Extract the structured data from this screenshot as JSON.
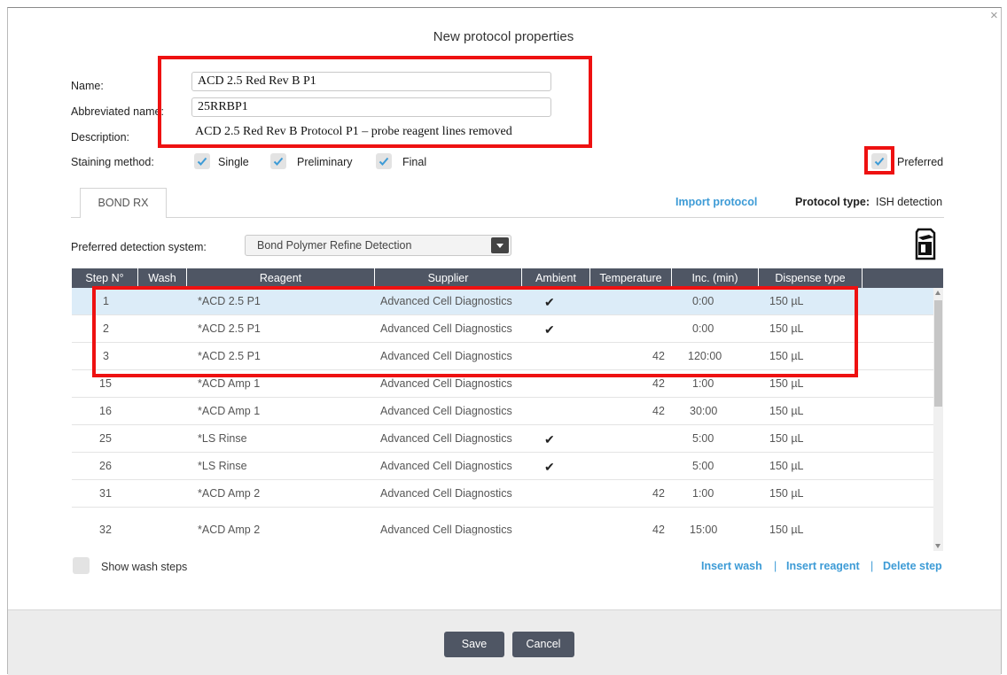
{
  "dialog": {
    "title": "New protocol properties",
    "close": "×"
  },
  "fields": {
    "name_label": "Name:",
    "name_value": "ACD 2.5 Red Rev B P1",
    "abbr_label": "Abbreviated name:",
    "abbr_value": "25RRBP1",
    "desc_label": "Description:",
    "desc_value": "ACD 2.5 Red Rev B Protocol P1 – probe reagent lines removed"
  },
  "staining": {
    "label": "Staining method:",
    "options": [
      {
        "label": "Single",
        "checked": true
      },
      {
        "label": "Preliminary",
        "checked": true
      },
      {
        "label": "Final",
        "checked": true
      }
    ],
    "preferred_label": "Preferred"
  },
  "tabs": {
    "bond_rx": "BOND RX"
  },
  "import_link": "Import protocol",
  "protocol_type": {
    "label": "Protocol type:",
    "value": "ISH detection"
  },
  "detection": {
    "label": "Preferred detection system:",
    "value": "Bond Polymer Refine Detection"
  },
  "table": {
    "headers": [
      "Step N°",
      "Wash",
      "Reagent",
      "Supplier",
      "Ambient",
      "Temperature",
      "Inc. (min)",
      "Dispense type"
    ],
    "rows": [
      {
        "step": "1",
        "wash": "",
        "reagent": "*ACD 2.5 P1",
        "supplier": "Advanced Cell Diagnostics",
        "ambient": "✔",
        "temp": "",
        "inc": "0:00",
        "dispense": "150 µL"
      },
      {
        "step": "2",
        "wash": "",
        "reagent": "*ACD 2.5 P1",
        "supplier": "Advanced Cell Diagnostics",
        "ambient": "✔",
        "temp": "",
        "inc": "0:00",
        "dispense": "150 µL"
      },
      {
        "step": "3",
        "wash": "",
        "reagent": "*ACD 2.5 P1",
        "supplier": "Advanced Cell Diagnostics",
        "ambient": "",
        "temp": "42",
        "inc": "120:00",
        "dispense": "150 µL"
      },
      {
        "step": "15",
        "wash": "",
        "reagent": "*ACD Amp 1",
        "supplier": "Advanced Cell Diagnostics",
        "ambient": "",
        "temp": "42",
        "inc": "1:00",
        "dispense": "150 µL"
      },
      {
        "step": "16",
        "wash": "",
        "reagent": "*ACD Amp 1",
        "supplier": "Advanced Cell Diagnostics",
        "ambient": "",
        "temp": "42",
        "inc": "30:00",
        "dispense": "150 µL"
      },
      {
        "step": "25",
        "wash": "",
        "reagent": "*LS Rinse",
        "supplier": "Advanced Cell Diagnostics",
        "ambient": "✔",
        "temp": "",
        "inc": "5:00",
        "dispense": "150 µL"
      },
      {
        "step": "26",
        "wash": "",
        "reagent": "*LS Rinse",
        "supplier": "Advanced Cell Diagnostics",
        "ambient": "✔",
        "temp": "",
        "inc": "5:00",
        "dispense": "150 µL"
      },
      {
        "step": "31",
        "wash": "",
        "reagent": "*ACD Amp 2",
        "supplier": "Advanced Cell Diagnostics",
        "ambient": "",
        "temp": "42",
        "inc": "1:00",
        "dispense": "150 µL"
      },
      {
        "step": "32",
        "wash": "",
        "reagent": "*ACD Amp 2",
        "supplier": "Advanced Cell Diagnostics",
        "ambient": "",
        "temp": "42",
        "inc": "15:00",
        "dispense": "150 µL"
      }
    ]
  },
  "show_wash_steps": "Show wash steps",
  "actions": {
    "insert_wash": "Insert wash",
    "insert_reagent": "Insert reagent",
    "delete_step": "Delete step",
    "separator": "|"
  },
  "buttons": {
    "save": "Save",
    "cancel": "Cancel"
  },
  "colors": {
    "accent": "#3d9bd6",
    "header_bg": "#4f5664",
    "selected_row": "#dcecf8",
    "annotation_red": "#ee1111"
  }
}
